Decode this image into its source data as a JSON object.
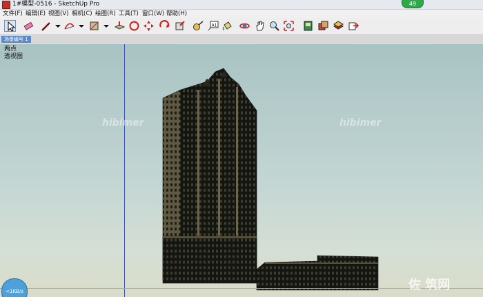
{
  "window": {
    "title": "1#模型-0516 - SketchUp Pro",
    "badge": "49"
  },
  "menu": [
    {
      "label": "文件(F)"
    },
    {
      "label": "编辑(E)"
    },
    {
      "label": "视图(V)"
    },
    {
      "label": "相机(C)"
    },
    {
      "label": "绘图(R)"
    },
    {
      "label": "工具(T)"
    },
    {
      "label": "窗口(W)"
    },
    {
      "label": "帮助(H)"
    }
  ],
  "toolbar": {
    "icons": [
      "select-icon",
      "eraser-icon",
      "pencil-icon",
      "arc-icon",
      "rectangle-icon",
      "push-pull-icon",
      "rotate-icon",
      "move-icon",
      "follow-me-icon",
      "offset-icon",
      "tape-measure-icon",
      "text-icon",
      "paint-bucket-icon",
      "orbit-icon",
      "pan-icon",
      "zoom-icon",
      "zoom-extents-icon",
      "components-icon",
      "materials-icon",
      "layers-icon",
      "export-icon"
    ]
  },
  "scene_tab": {
    "label": "场景编号 1"
  },
  "viewport": {
    "labels": [
      "两点",
      "透视图"
    ],
    "watermarks": [
      "hibimer",
      "hibimer"
    ],
    "speed": "<1KB/s",
    "site_logo": "佐 筑网"
  },
  "colors": {
    "sky": "#a8c3c3",
    "axis_blue": "#3d4fbf",
    "ground": "#bfa28a",
    "scene_tab": "#5b8ac9"
  }
}
